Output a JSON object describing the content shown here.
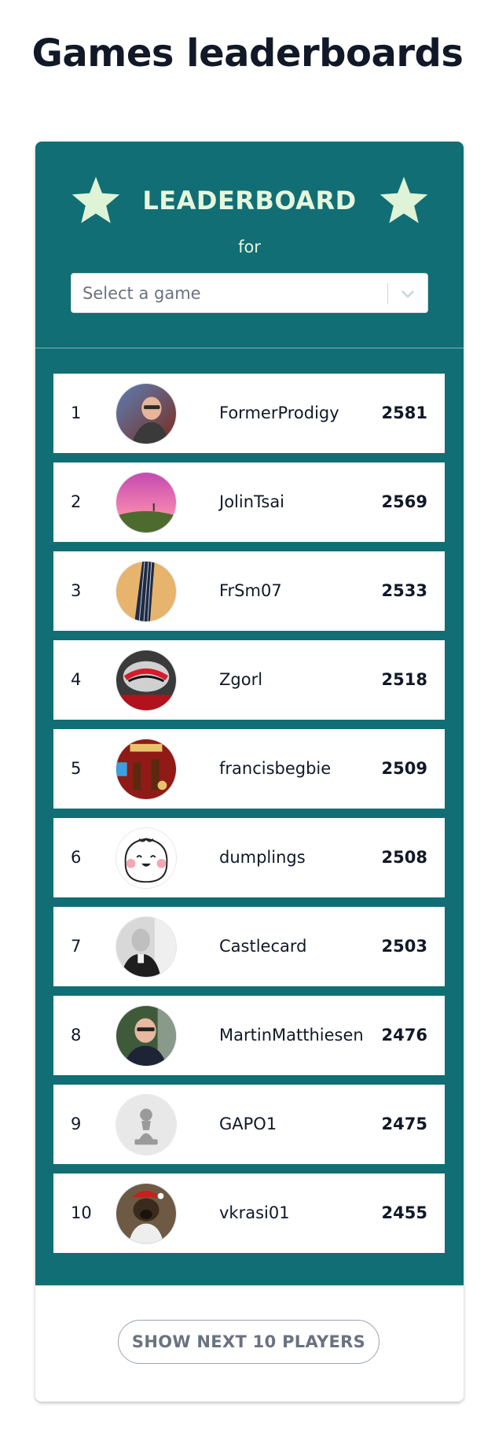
{
  "page": {
    "title": "Games leaderboards"
  },
  "leaderboard": {
    "title": "LEADERBOARD",
    "for_label": "for",
    "select": {
      "placeholder": "Select a game"
    },
    "players": [
      {
        "rank": "1",
        "username": "FormerProdigy",
        "score": "2581",
        "avatar": "photo-man-glasses"
      },
      {
        "rank": "2",
        "username": "JolinTsai",
        "score": "2569",
        "avatar": "pink-sky-landscape"
      },
      {
        "rank": "3",
        "username": "FrSm07",
        "score": "2533",
        "avatar": "bass-guitar-neck"
      },
      {
        "rank": "4",
        "username": "Zgorl",
        "score": "2518",
        "avatar": "bike-helmet"
      },
      {
        "rank": "5",
        "username": "francisbegbie",
        "score": "2509",
        "avatar": "game-artwork"
      },
      {
        "rank": "6",
        "username": "dumplings",
        "score": "2508",
        "avatar": "dumpling-cartoon"
      },
      {
        "rank": "7",
        "username": "Castlecard",
        "score": "2503",
        "avatar": "bw-portrait"
      },
      {
        "rank": "8",
        "username": "MartinMatthiesen",
        "score": "2476",
        "avatar": "photo-man-glasses"
      },
      {
        "rank": "9",
        "username": "GAPO1",
        "score": "2475",
        "avatar": "chess-pawn-default"
      },
      {
        "rank": "10",
        "username": "vkrasi01",
        "score": "2455",
        "avatar": "dog-santa-hat"
      }
    ],
    "show_next_label": "SHOW NEXT 10 PLAYERS"
  },
  "colors": {
    "accent": "#116e74",
    "title_text": "#e6f6dc",
    "star": "#dff3d6"
  }
}
